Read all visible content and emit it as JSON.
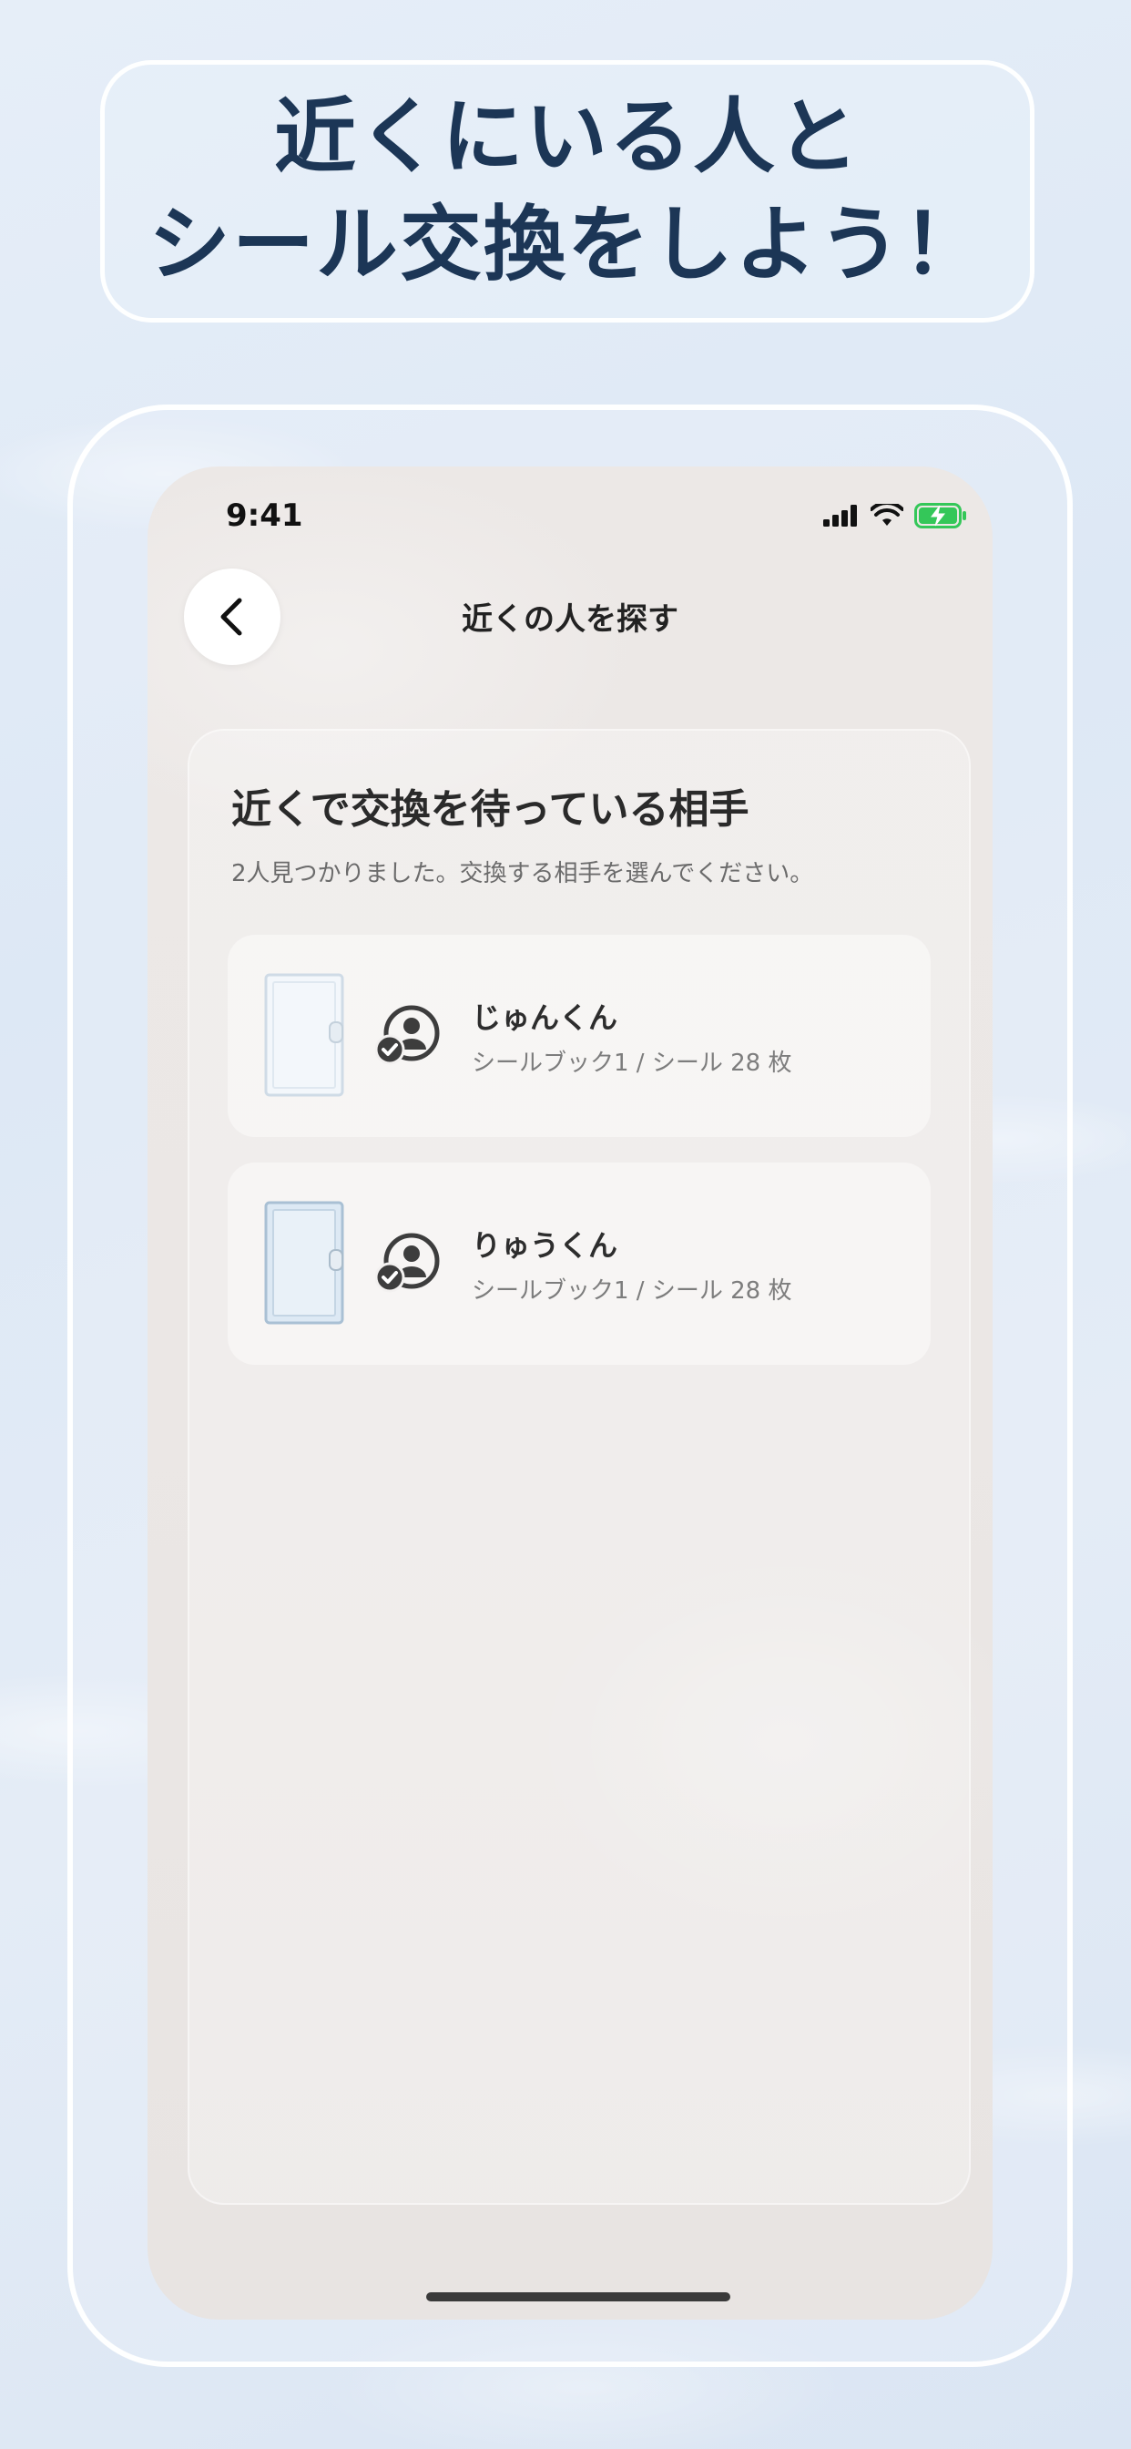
{
  "headline": {
    "line1": "近くにいる人と",
    "line2": "シール交換をしよう！"
  },
  "status_bar": {
    "time": "9:41"
  },
  "nav": {
    "title": "近くの人を探す",
    "back_icon": "chevron-left-icon"
  },
  "panel": {
    "title": "近くで交換を待っている相手",
    "subtitle": "2人見つかりました。交換する相手を選んでください。"
  },
  "users": [
    {
      "name": "じゅんくん",
      "meta": "シールブック1 / シール 28 枚"
    },
    {
      "name": "りゅうくん",
      "meta": "シールブック1 / シール 28 枚"
    }
  ],
  "colors": {
    "headline_text": "#1c3656",
    "battery_green": "#34c759",
    "background": "#e1eaf6"
  }
}
